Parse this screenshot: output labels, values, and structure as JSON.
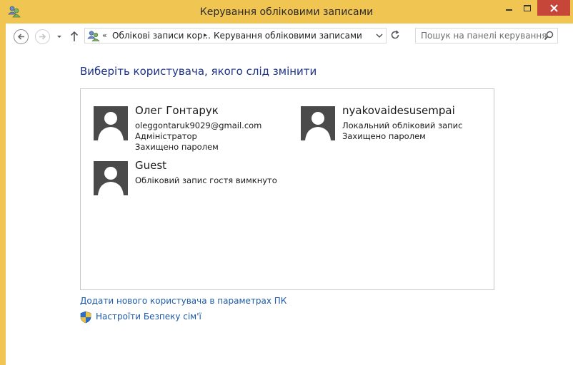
{
  "window": {
    "title": "Керування обліковими записами"
  },
  "navbar": {
    "breadcrumb_sep_first": "«",
    "breadcrumb": [
      {
        "label": "Облікові записи кор..."
      },
      {
        "label": "Керування обліковими записами"
      }
    ],
    "crumb_arrow": "▸",
    "search_placeholder": "Пошук на панелі керування"
  },
  "main": {
    "heading": "Виберіть користувача, якого слід змінити",
    "accounts": [
      {
        "name": "Олег Гонтарук",
        "lines": [
          "oleggontaruk9029@gmail.com",
          "Адміністратор",
          "Захищено паролем"
        ]
      },
      {
        "name": "nyakovaidesusempai",
        "lines": [
          "Локальний обліковий запис",
          "Захищено паролем"
        ]
      },
      {
        "name": "Guest",
        "lines": [
          "Обліковий запис гостя вимкнуто"
        ]
      }
    ],
    "links": {
      "add_user": "Додати нового користувача в параметрах ПК",
      "family_safety": "Настроїти Безпеку сім'ї"
    }
  },
  "colors": {
    "titlebar": "#f0c552",
    "close_button": "#c7463a",
    "heading": "#1e3287",
    "link": "#1e5aa8",
    "avatar": "#4a4a4a"
  }
}
